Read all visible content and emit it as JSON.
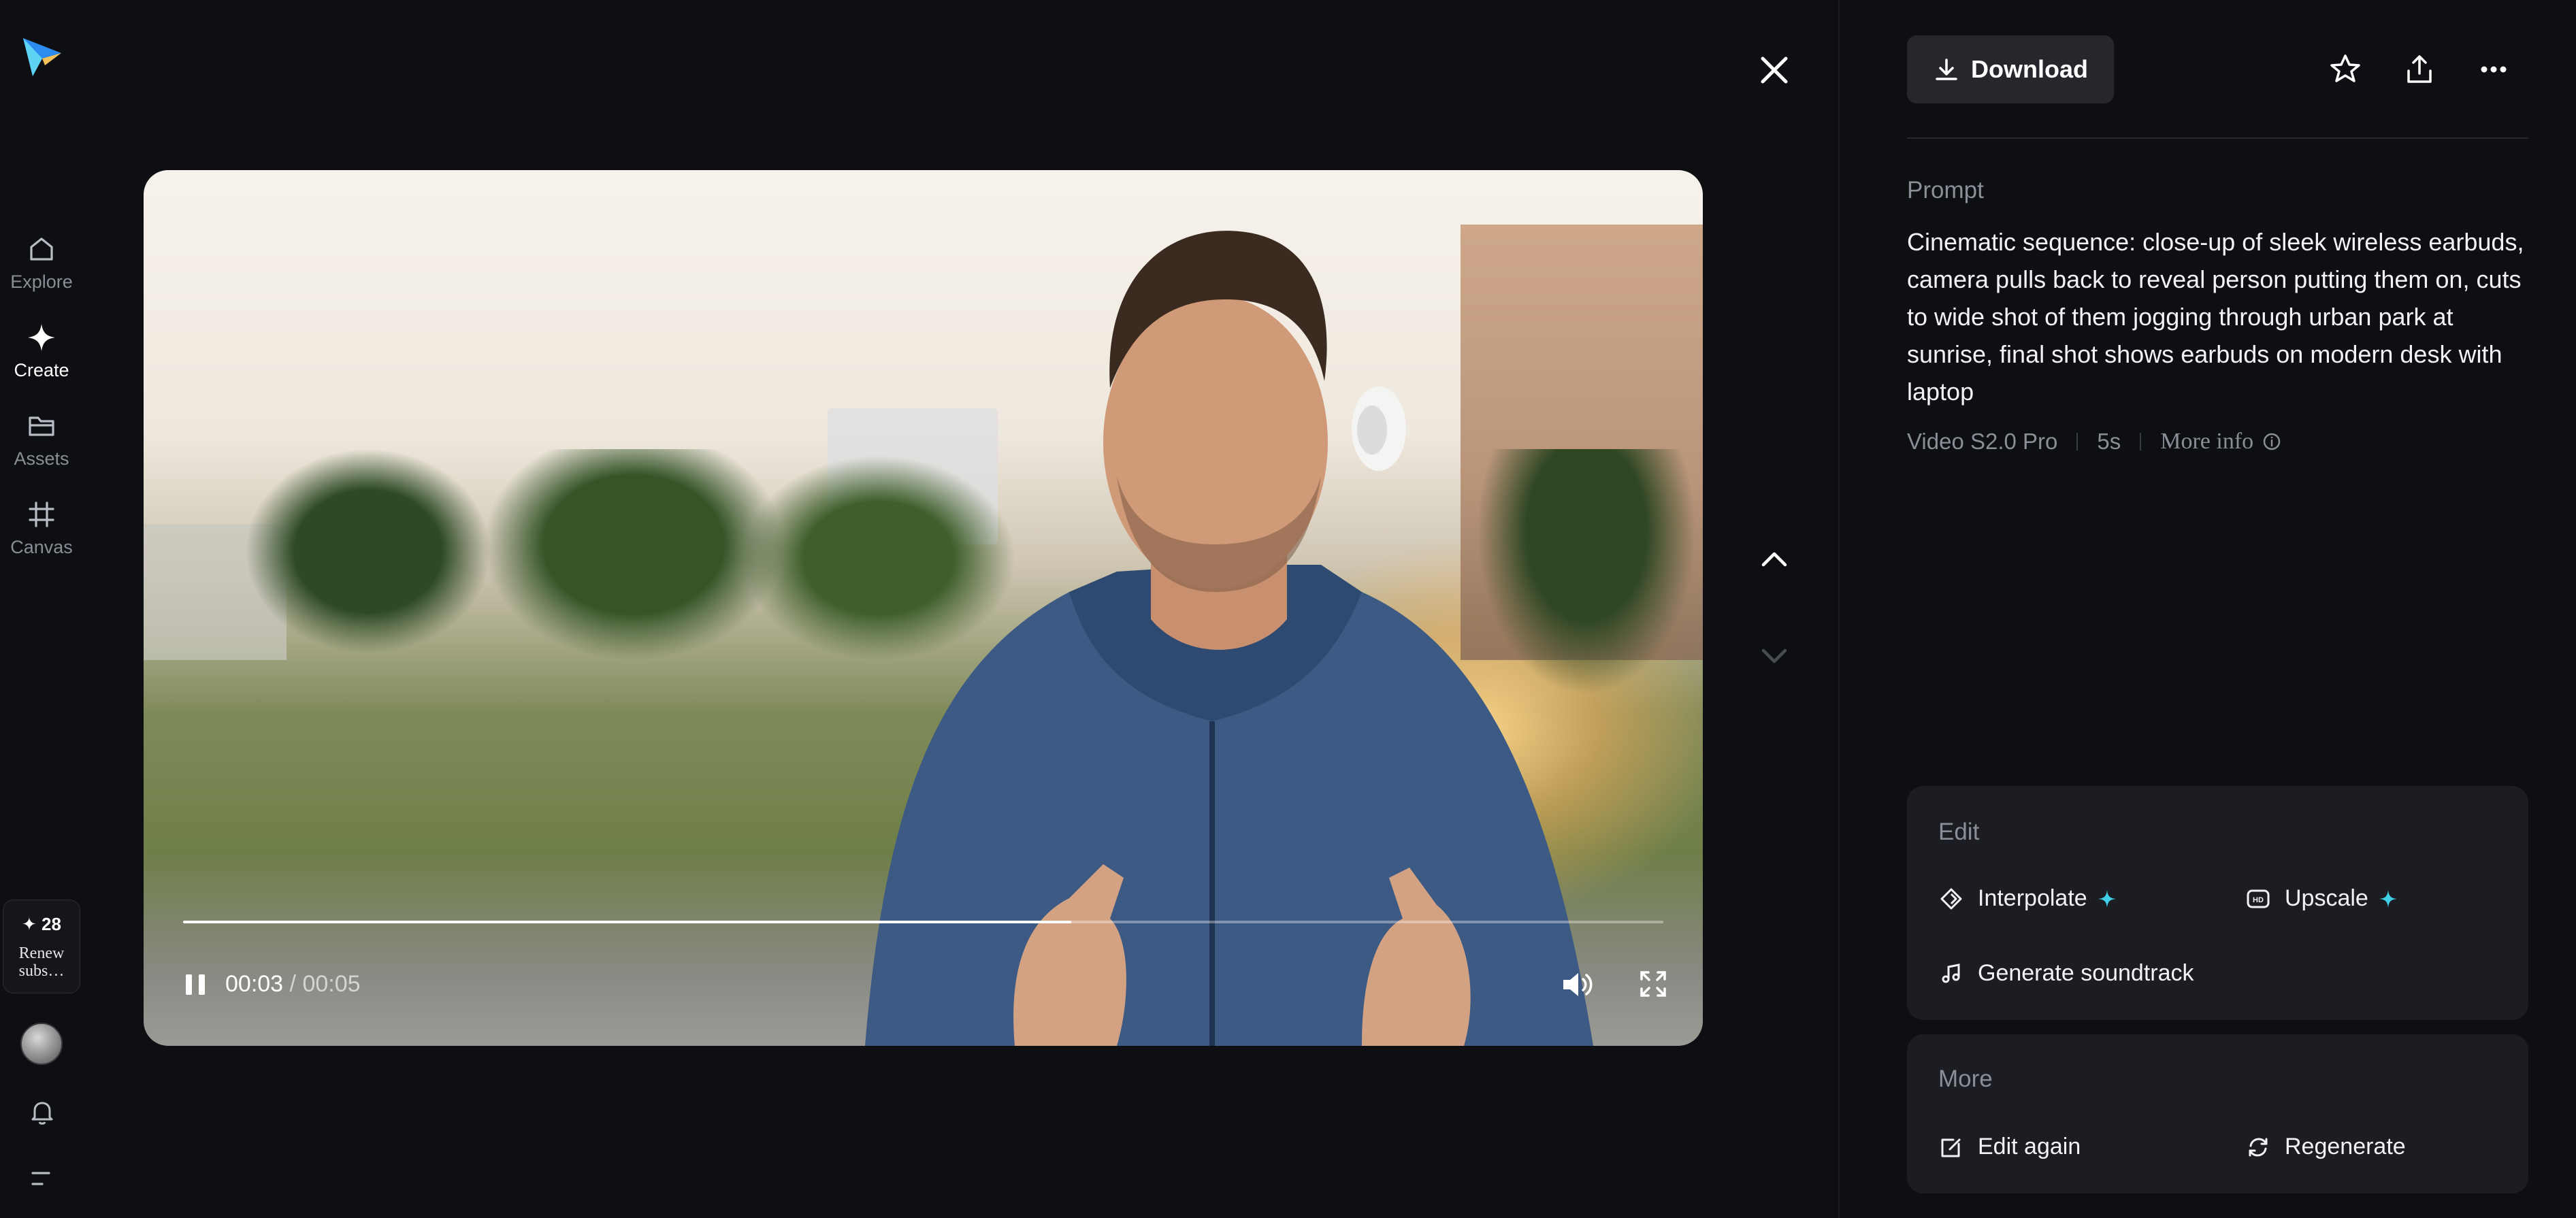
{
  "sidebar": {
    "items": [
      {
        "label": "Explore",
        "icon": "home-icon"
      },
      {
        "label": "Create",
        "icon": "sparkle-icon"
      },
      {
        "label": "Assets",
        "icon": "folder-icon"
      },
      {
        "label": "Canvas",
        "icon": "grid-frame-icon"
      }
    ],
    "credits": {
      "count": "✦ 28",
      "renew_label": "Renew subs…"
    }
  },
  "player": {
    "current_time": "00:03",
    "separator": " / ",
    "duration": "00:05",
    "progress": 0.6,
    "state": "playing"
  },
  "toolbar": {
    "download_label": "Download"
  },
  "details": {
    "prompt_label": "Prompt",
    "prompt_text": "Cinematic sequence: close-up of sleek wireless earbuds, camera pulls back to reveal person putting them on, cuts to wide shot of them jogging through urban park at sunrise, final shot shows earbuds on modern desk with laptop",
    "model": "Video S2.0 Pro",
    "length": "5s",
    "more_info_label": "More info"
  },
  "edit_card": {
    "title": "Edit",
    "actions": [
      {
        "label": "Interpolate",
        "icon": "diamond-icon",
        "premium": true
      },
      {
        "label": "Upscale",
        "icon": "hd-icon",
        "premium": true
      },
      {
        "label": "Generate soundtrack",
        "icon": "music-note-icon",
        "premium": false
      }
    ]
  },
  "more_card": {
    "title": "More",
    "actions": [
      {
        "label": "Edit again",
        "icon": "edit-icon"
      },
      {
        "label": "Regenerate",
        "icon": "refresh-icon"
      }
    ]
  },
  "colors": {
    "background": "#0e0f13",
    "card": "#1c1d22",
    "accent_spark": "#3fd0e8",
    "muted_text": "#8b8e97"
  }
}
